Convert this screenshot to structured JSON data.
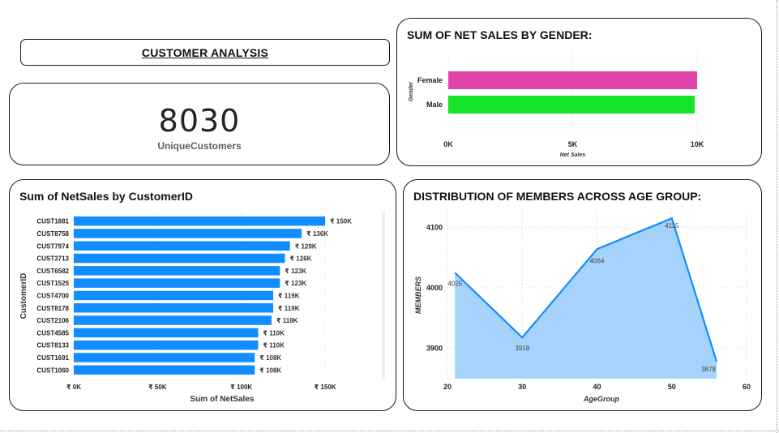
{
  "header": {
    "title": "CUSTOMER ANALYSIS"
  },
  "kpi": {
    "value": "8030",
    "label": "UniqueCustomers"
  },
  "chart_data": [
    {
      "id": "gender",
      "type": "bar",
      "orientation": "horizontal",
      "title": "SUM OF NET SALES BY GENDER:",
      "xlabel": "Net Sales",
      "ylabel": "Gender",
      "categories": [
        "Female",
        "Male"
      ],
      "values": [
        10000,
        9900
      ],
      "colors": [
        "#e044a7",
        "#15e52a"
      ],
      "xlim": [
        0,
        10000
      ],
      "xticks": [
        0,
        5000,
        10000
      ],
      "xtick_labels": [
        "0K",
        "5K",
        "10K"
      ],
      "grid": true
    },
    {
      "id": "customers",
      "type": "bar",
      "orientation": "horizontal",
      "title": "Sum of NetSales by CustomerID",
      "xlabel": "Sum of NetSales",
      "ylabel": "CustomerID",
      "categories": [
        "CUST1881",
        "CUST8758",
        "CUST7974",
        "CUST3713",
        "CUST6582",
        "CUST1525",
        "CUST4700",
        "CUST8178",
        "CUST2106",
        "CUST4585",
        "CUST8133",
        "CUST1691",
        "CUST1060"
      ],
      "values": [
        150000,
        136000,
        129000,
        126000,
        123000,
        123000,
        119000,
        119000,
        118000,
        110000,
        110000,
        108000,
        108000
      ],
      "data_labels": [
        "₹ 150K",
        "₹ 136K",
        "₹ 129K",
        "₹ 126K",
        "₹ 123K",
        "₹ 123K",
        "₹ 119K",
        "₹ 119K",
        "₹ 118K",
        "₹ 110K",
        "₹ 110K",
        "₹ 108K",
        "₹ 108K"
      ],
      "color": "#118dff",
      "xlim": [
        0,
        163000
      ],
      "xticks": [
        0,
        50000,
        100000,
        150000
      ],
      "xtick_labels": [
        "₹ 0K",
        "₹ 50K",
        "₹ 100K",
        "₹ 150K"
      ],
      "grid": true
    },
    {
      "id": "age",
      "type": "area",
      "title": "DISTRIBUTION OF MEMBERS ACROSS AGE GROUP:",
      "xlabel": "AgeGroup",
      "ylabel": "MEMBERS",
      "x": [
        21,
        30,
        40,
        50,
        56
      ],
      "y": [
        4025,
        3918,
        4064,
        4115,
        3878
      ],
      "data_labels": [
        "4025",
        "3918",
        "4064",
        "4115",
        "3878"
      ],
      "line_color": "#118dff",
      "fill_color": "#a6d3fb",
      "xlim": [
        20,
        60
      ],
      "ylim": [
        3850,
        4130
      ],
      "xticks": [
        20,
        30,
        40,
        50,
        60
      ],
      "xtick_labels": [
        "20",
        "30",
        "40",
        "50",
        "60"
      ],
      "yticks": [
        3900,
        4000,
        4100
      ],
      "ytick_labels": [
        "3900",
        "4000",
        "4100"
      ],
      "grid": true
    }
  ]
}
